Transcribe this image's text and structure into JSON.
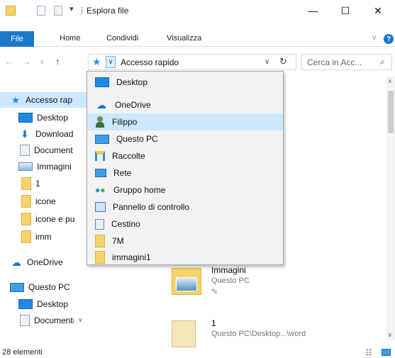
{
  "window": {
    "title": "Esplora file"
  },
  "titlebar": {
    "minimize": "—",
    "maximize": "☐",
    "close": "✕"
  },
  "ribbon": {
    "file_tab": "File",
    "tabs": [
      "Home",
      "Condividi",
      "Visualizza"
    ]
  },
  "address": {
    "path": "Accesso rapido",
    "search_placeholder": "Cerca in Acc..."
  },
  "sidebar": {
    "quick_access": "Accesso rap",
    "items": [
      "Desktop",
      "Download",
      "Document",
      "Immagini",
      "1",
      "icone",
      "icone e pu",
      "imm"
    ],
    "onedrive": "OneDrive",
    "this_pc": "Questo PC",
    "pc_items": [
      "Desktop",
      "Documenti"
    ]
  },
  "dropdown": {
    "items": [
      {
        "label": "Desktop",
        "icon": "desktop-icon"
      },
      {
        "label": "OneDrive",
        "icon": "cloud-icon"
      },
      {
        "label": "Filippo",
        "icon": "user-icon"
      },
      {
        "label": "Questo PC",
        "icon": "computer-icon"
      },
      {
        "label": "Raccolte",
        "icon": "libraries-icon"
      },
      {
        "label": "Rete",
        "icon": "network-icon"
      },
      {
        "label": "Gruppo home",
        "icon": "homegroup-icon"
      },
      {
        "label": "Pannello di controllo",
        "icon": "control-panel-icon"
      },
      {
        "label": "Cestino",
        "icon": "recycle-bin-icon"
      },
      {
        "label": "7M",
        "icon": "folder-icon"
      },
      {
        "label": "immagini1",
        "icon": "folder-icon"
      }
    ],
    "highlighted": "Filippo"
  },
  "content": {
    "items": [
      {
        "name": "Immagini",
        "location": "Questo PC"
      },
      {
        "name": "1",
        "location": "Questo PC\\Desktop...\\word"
      }
    ]
  },
  "status": {
    "count": "28 elementi"
  }
}
